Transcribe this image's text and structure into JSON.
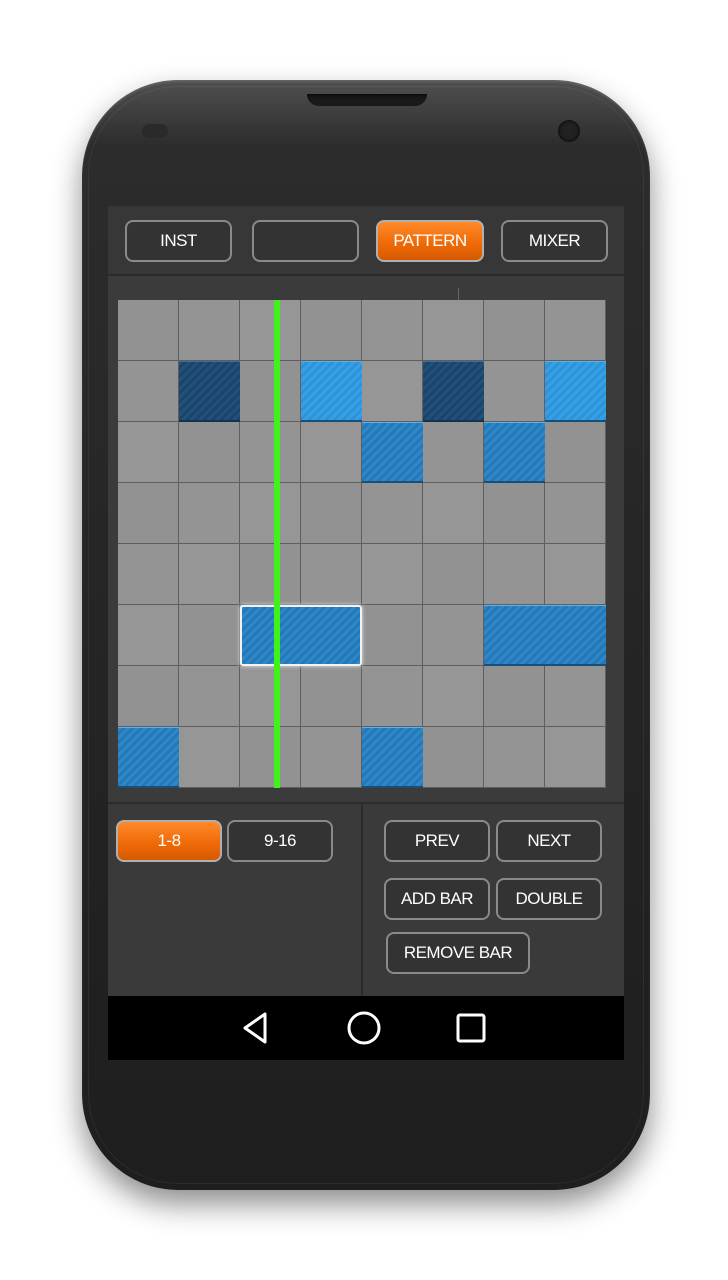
{
  "top_tabs": [
    "INST",
    "",
    "PATTERN",
    "MIXER"
  ],
  "active_tab": "PATTERN",
  "grid": {
    "columns": 8,
    "rows": 8,
    "playhead_step": 2.6,
    "notes": [
      {
        "row": 1,
        "col": 1,
        "length": 1,
        "style": "dark"
      },
      {
        "row": 1,
        "col": 3,
        "length": 1,
        "style": "light"
      },
      {
        "row": 1,
        "col": 5,
        "length": 1,
        "style": "dark"
      },
      {
        "row": 1,
        "col": 7,
        "length": 1,
        "style": "light"
      },
      {
        "row": 2,
        "col": 4,
        "length": 1,
        "style": "normal"
      },
      {
        "row": 2,
        "col": 6,
        "length": 1,
        "style": "normal"
      },
      {
        "row": 5,
        "col": 2,
        "length": 2,
        "style": "selected"
      },
      {
        "row": 5,
        "col": 6,
        "length": 2,
        "style": "normal"
      },
      {
        "row": 7,
        "col": 0,
        "length": 1,
        "style": "normal"
      },
      {
        "row": 7,
        "col": 4,
        "length": 1,
        "style": "normal"
      }
    ]
  },
  "bottom": {
    "range_buttons": [
      "1-8",
      "9-16"
    ],
    "active_range": "1-8",
    "prev_label": "PREV",
    "next_label": "NEXT",
    "add_bar_label": "ADD BAR",
    "double_label": "DOUBLE",
    "remove_bar_label": "REMOVE BAR"
  },
  "colors": {
    "accent_orange": "#f06a08",
    "note_blue": "#2d87c8",
    "note_dark": "#21507a",
    "playhead_green": "#3ef21a"
  },
  "nav": {
    "icons": [
      "back-icon",
      "home-icon",
      "recents-icon"
    ]
  }
}
